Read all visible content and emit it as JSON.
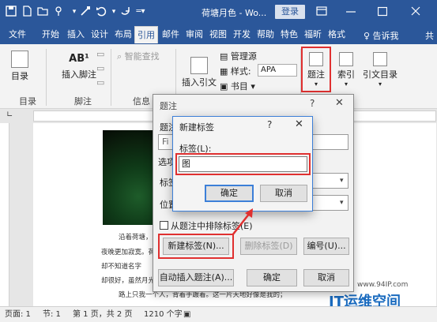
{
  "title_bar": {
    "doc_title": "荷塘月色 - Wo...",
    "login_label": "登录",
    "quick_access_icons": [
      "save-icon",
      "new-doc-icon",
      "open-icon",
      "touch-mode-icon",
      "format-painter-icon",
      "undo-icon",
      "redo-icon",
      "customize-icon"
    ],
    "window_icons": [
      "ribbon-display-icon",
      "minimize-icon",
      "restore-icon",
      "close-icon"
    ]
  },
  "tabs": [
    "文件",
    "开始",
    "插入",
    "设计",
    "布局",
    "引用",
    "邮件",
    "审阅",
    "视图",
    "开发",
    "帮助",
    "特色",
    "福昕",
    "格式"
  ],
  "active_tab": "引用",
  "tell_me": "♀ 告诉我",
  "share_label": "共",
  "ribbon": {
    "toc_label": "目录",
    "toc_group": "目录",
    "insert_footnote": "插入脚注",
    "footnote_icon_text": "AB¹",
    "footnote_group": "脚注",
    "smart_lookup": "智能查找",
    "info_group": "信息",
    "insert_citation": "插入引文",
    "manage_sources": "管理源",
    "style_label": "样式:",
    "style_value": "APA",
    "bibliography": "书目",
    "caption": "题注",
    "index": "索引",
    "citation_index": "引文目录"
  },
  "caption_dialog": {
    "title": "题注",
    "help": "?",
    "caption_label": "题注",
    "caption_value": "Fi",
    "options_label": "选项",
    "label_label": "标签",
    "position_label": "位置",
    "exclude_label": "从题注中排除标签(E)",
    "new_label_button": "新建标签(N)...",
    "delete_label_button": "删除标签(D)",
    "numbering_button": "编号(U)...",
    "auto_caption_button": "自动插入题注(A)...",
    "ok": "确定",
    "cancel": "取消"
  },
  "new_label_dialog": {
    "title": "新建标签",
    "help": "?",
    "label_prompt": "标签(L):",
    "label_value": "图",
    "ok": "确定",
    "cancel": "取消"
  },
  "document_lines": [
    "沿着荷塘，是",
    "夜晚更加寂寞。荷",
    "却不知道名字",
    "却很好，虽然月光",
    "路上只我一个人，背着手踱着。这一片天地好像是我的；"
  ],
  "status_bar": {
    "page": "页面: 1",
    "section": "节: 1",
    "page_of": "第 1 页，共 2 页",
    "word_count": "1210 个字"
  },
  "watermark": {
    "url": "www.94IP.com",
    "logo": "IT运维空间"
  },
  "colors": {
    "brand": "#2b579a",
    "highlight": "#e03030",
    "focus": "#3c7fd8"
  }
}
